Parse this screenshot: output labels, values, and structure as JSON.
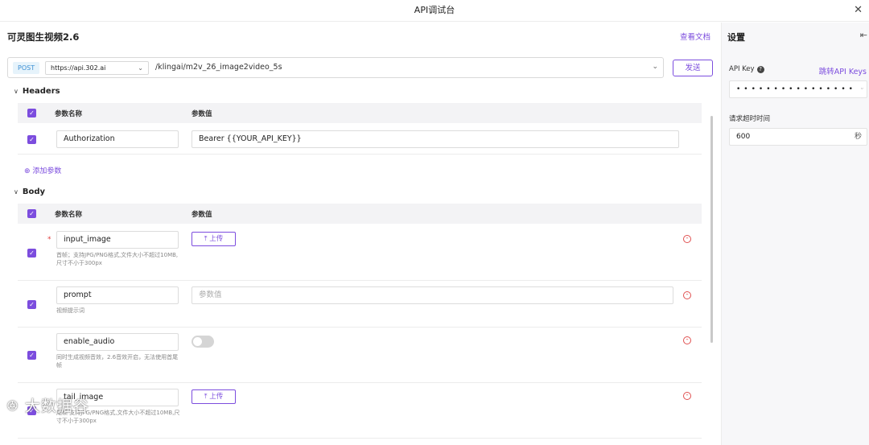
{
  "window": {
    "title": "API调试台",
    "close_icon": "close-icon"
  },
  "main": {
    "title": "可灵图生视频2.6",
    "doc_link": "查看文档",
    "method": "POST",
    "host": "https://api.302.ai",
    "path": "/klingai/m2v_26_image2video_5s",
    "send_label": "发送"
  },
  "headers": {
    "label": "Headers",
    "col_name": "参数名称",
    "col_value": "参数值",
    "rows": [
      {
        "name": "Authorization",
        "value": "Bearer {{YOUR_API_KEY}}"
      }
    ],
    "add_label": "添加参数"
  },
  "body": {
    "label": "Body",
    "col_name": "参数名称",
    "col_value": "参数值",
    "rows": [
      {
        "name": "input_image",
        "hint": "首帧；支持JPG/PNG格式,文件大小不超过10MB,尺寸不小于300px",
        "upload_label": "上传",
        "required_mark": "*"
      },
      {
        "name": "prompt",
        "hint": "视频提示词",
        "placeholder": "参数值"
      },
      {
        "name": "enable_audio",
        "hint": "同时生成视频音效，2.6音效开启，无法使用首尾帧",
        "toggle_on": false
      },
      {
        "name": "tail_image",
        "hint": "尾帧 支持JPG/PNG格式,文件大小不超过10MB,尺寸不小于300px",
        "upload_label": "上传"
      }
    ]
  },
  "watermark": "大数据谷",
  "settings": {
    "title": "设置",
    "api_key_label": "API Key",
    "api_key_link": "跳转API Keys",
    "api_key_value": "••••••••••••••••",
    "timeout_label": "请求超时时间",
    "timeout_value": "600",
    "timeout_unit": "秒"
  },
  "colors": {
    "accent": "#7c4dde",
    "danger": "#e05050",
    "method_bg": "#e6f3fb"
  }
}
